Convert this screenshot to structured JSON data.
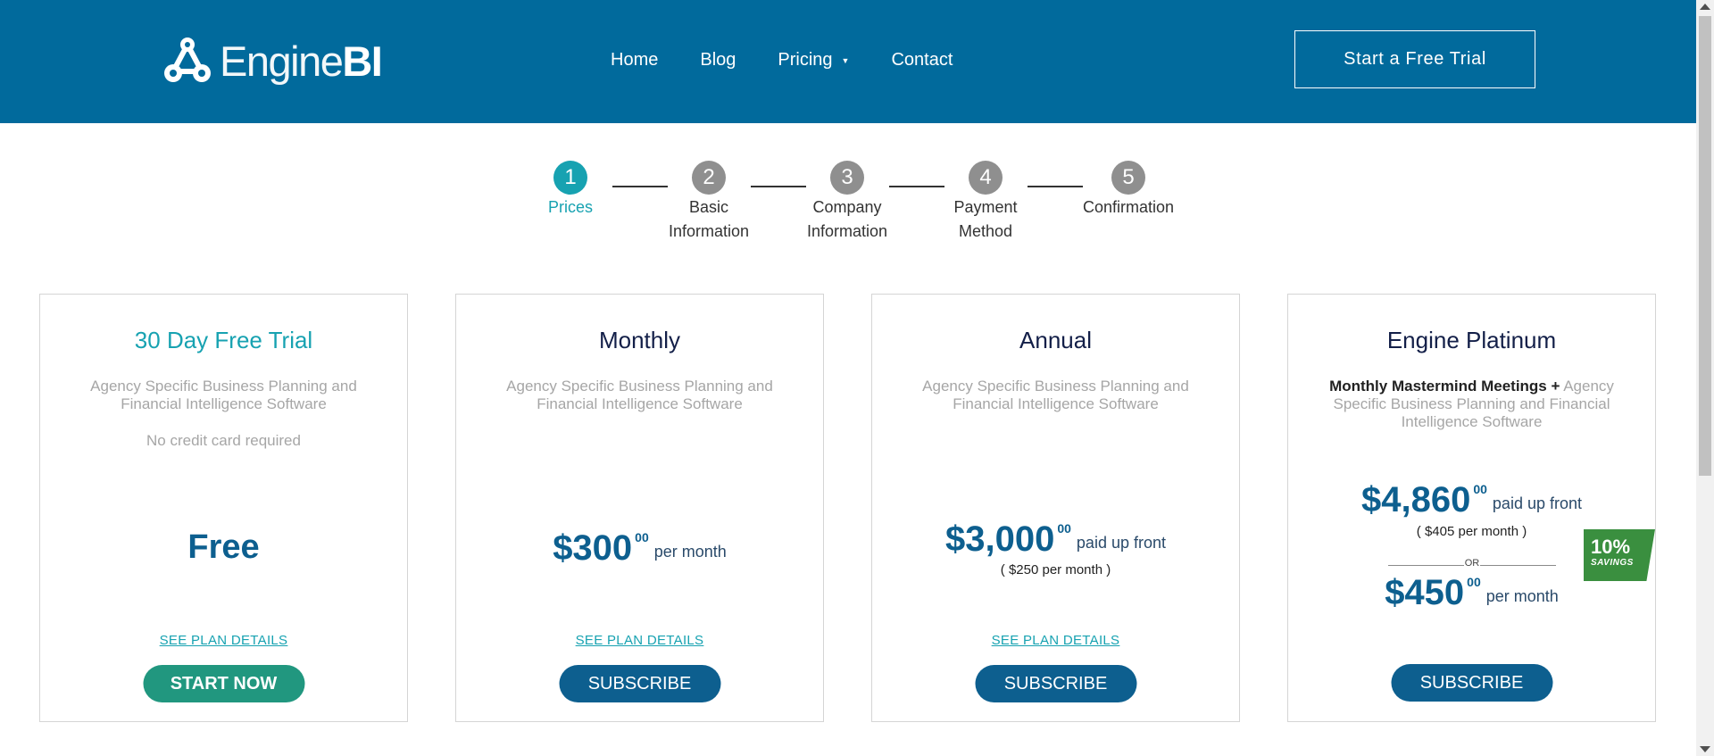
{
  "header": {
    "logo": {
      "text_light": "Engine",
      "text_bold": "BI",
      "icon": "engine-network-logo-icon"
    },
    "nav": [
      {
        "label": "Home"
      },
      {
        "label": "Blog"
      },
      {
        "label": "Pricing",
        "has_dropdown": true
      },
      {
        "label": "Contact"
      }
    ],
    "cta_label": "Start a Free Trial"
  },
  "stepper": {
    "steps": [
      {
        "number": "1",
        "label": "Prices",
        "active": true
      },
      {
        "number": "2",
        "label_line1": "Basic",
        "label_line2": "Information"
      },
      {
        "number": "3",
        "label_line1": "Company",
        "label_line2": "Information"
      },
      {
        "number": "4",
        "label_line1": "Payment",
        "label_line2": "Method"
      },
      {
        "number": "5",
        "label": "Confirmation"
      }
    ]
  },
  "plans": [
    {
      "title": "30 Day Free Trial",
      "description": "Agency Specific Business Planning and Financial Intelligence Software",
      "note": "No credit card required",
      "price_text": "Free",
      "details_link": "SEE PLAN DETAILS",
      "button": "START NOW"
    },
    {
      "title": "Monthly",
      "description": "Agency Specific Business Planning and Financial Intelligence Software",
      "price": "$300",
      "cents": "00",
      "suffix": "per month",
      "details_link": "SEE PLAN DETAILS",
      "button": "SUBSCRIBE"
    },
    {
      "title": "Annual",
      "description": "Agency Specific Business Planning and Financial Intelligence Software",
      "price": "$3,000",
      "cents": "00",
      "suffix": "paid up front",
      "sub": "( $250 per month )",
      "details_link": "SEE PLAN DETAILS",
      "button": "SUBSCRIBE"
    },
    {
      "title": "Engine Platinum",
      "description_bold": "Monthly Mastermind Meetings +",
      "description": "Agency Specific Business Planning and Financial Intelligence Software",
      "price": "$4,860",
      "cents": "00",
      "suffix": "paid up front",
      "sub": "( $405 per month )",
      "or_label": "OR",
      "alt_price": "$450",
      "alt_cents": "00",
      "alt_suffix": "per month",
      "badge_percent": "10%",
      "badge_label": "SAVINGS",
      "button": "SUBSCRIBE"
    }
  ],
  "colors": {
    "header_bg": "#016a9c",
    "accent_teal": "#17a2b1",
    "price_blue": "#0d5f8f",
    "start_green": "#21977f",
    "badge_green": "#3a8f3f",
    "step_inactive": "#8f8f8f"
  }
}
